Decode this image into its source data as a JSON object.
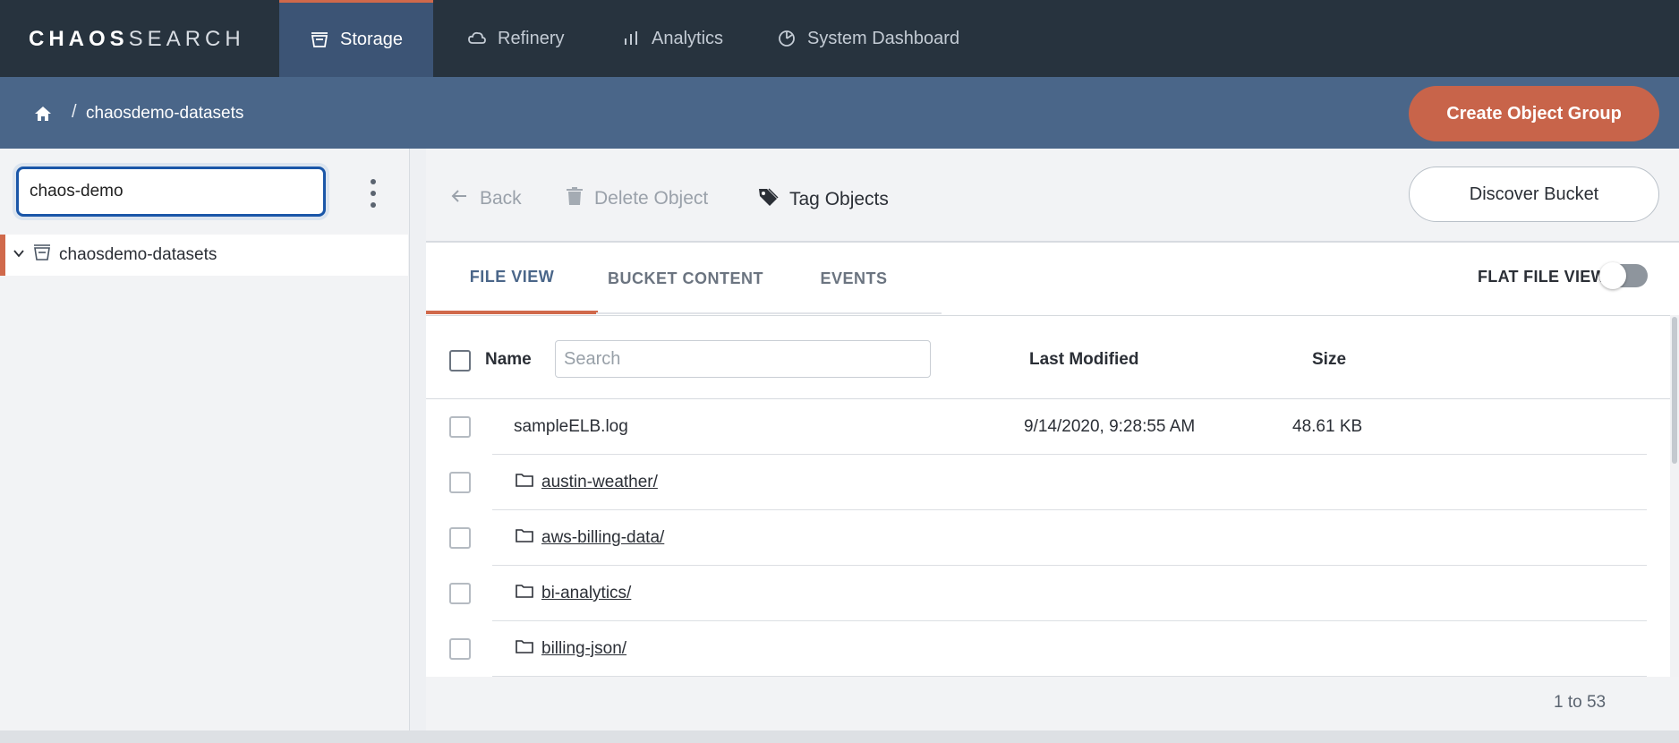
{
  "brand": {
    "logo_light": "CHAOS",
    "logo_bold": "SEARCH"
  },
  "nav": {
    "tabs": [
      {
        "label": "Storage",
        "icon": "storage-icon",
        "active": true
      },
      {
        "label": "Refinery",
        "icon": "cloud-icon",
        "active": false
      },
      {
        "label": "Analytics",
        "icon": "bar-chart-icon",
        "active": false
      },
      {
        "label": "System Dashboard",
        "icon": "dashboard-icon",
        "active": false
      }
    ]
  },
  "breadcrumb": {
    "separator": "/",
    "current": "chaosdemo-datasets"
  },
  "header": {
    "create_button": "Create Object Group"
  },
  "sidebar": {
    "search_value": "chaos-demo",
    "tree": [
      {
        "label": "chaosdemo-datasets",
        "expanded": true
      }
    ]
  },
  "toolbar": {
    "back": "Back",
    "delete": "Delete Object",
    "tag": "Tag Objects",
    "discover": "Discover Bucket"
  },
  "tabs": {
    "items": [
      {
        "label": "FILE VIEW",
        "active": true
      },
      {
        "label": "BUCKET CONTENT",
        "active": false
      },
      {
        "label": "EVENTS",
        "active": false
      }
    ],
    "flat_file_view": {
      "label": "FLAT FILE VIEW",
      "on": false
    }
  },
  "table": {
    "columns": {
      "name": "Name",
      "last_modified": "Last Modified",
      "size": "Size"
    },
    "search_placeholder": "Search",
    "rows": [
      {
        "type": "file",
        "name": "sampleELB.log",
        "last_modified": "9/14/2020, 9:28:55 AM",
        "size": "48.61 KB"
      },
      {
        "type": "folder",
        "name": "austin-weather/",
        "last_modified": "",
        "size": ""
      },
      {
        "type": "folder",
        "name": "aws-billing-data/",
        "last_modified": "",
        "size": ""
      },
      {
        "type": "folder",
        "name": "bi-analytics/",
        "last_modified": "",
        "size": ""
      },
      {
        "type": "folder",
        "name": "billing-json/",
        "last_modified": "",
        "size": ""
      }
    ],
    "pagination": "1 to 53"
  },
  "colors": {
    "topnav": "#27333e",
    "active_tab": "#3c5475",
    "subheader": "#4a6689",
    "accent": "#d0694b",
    "focus_blue": "#1a56a8"
  }
}
